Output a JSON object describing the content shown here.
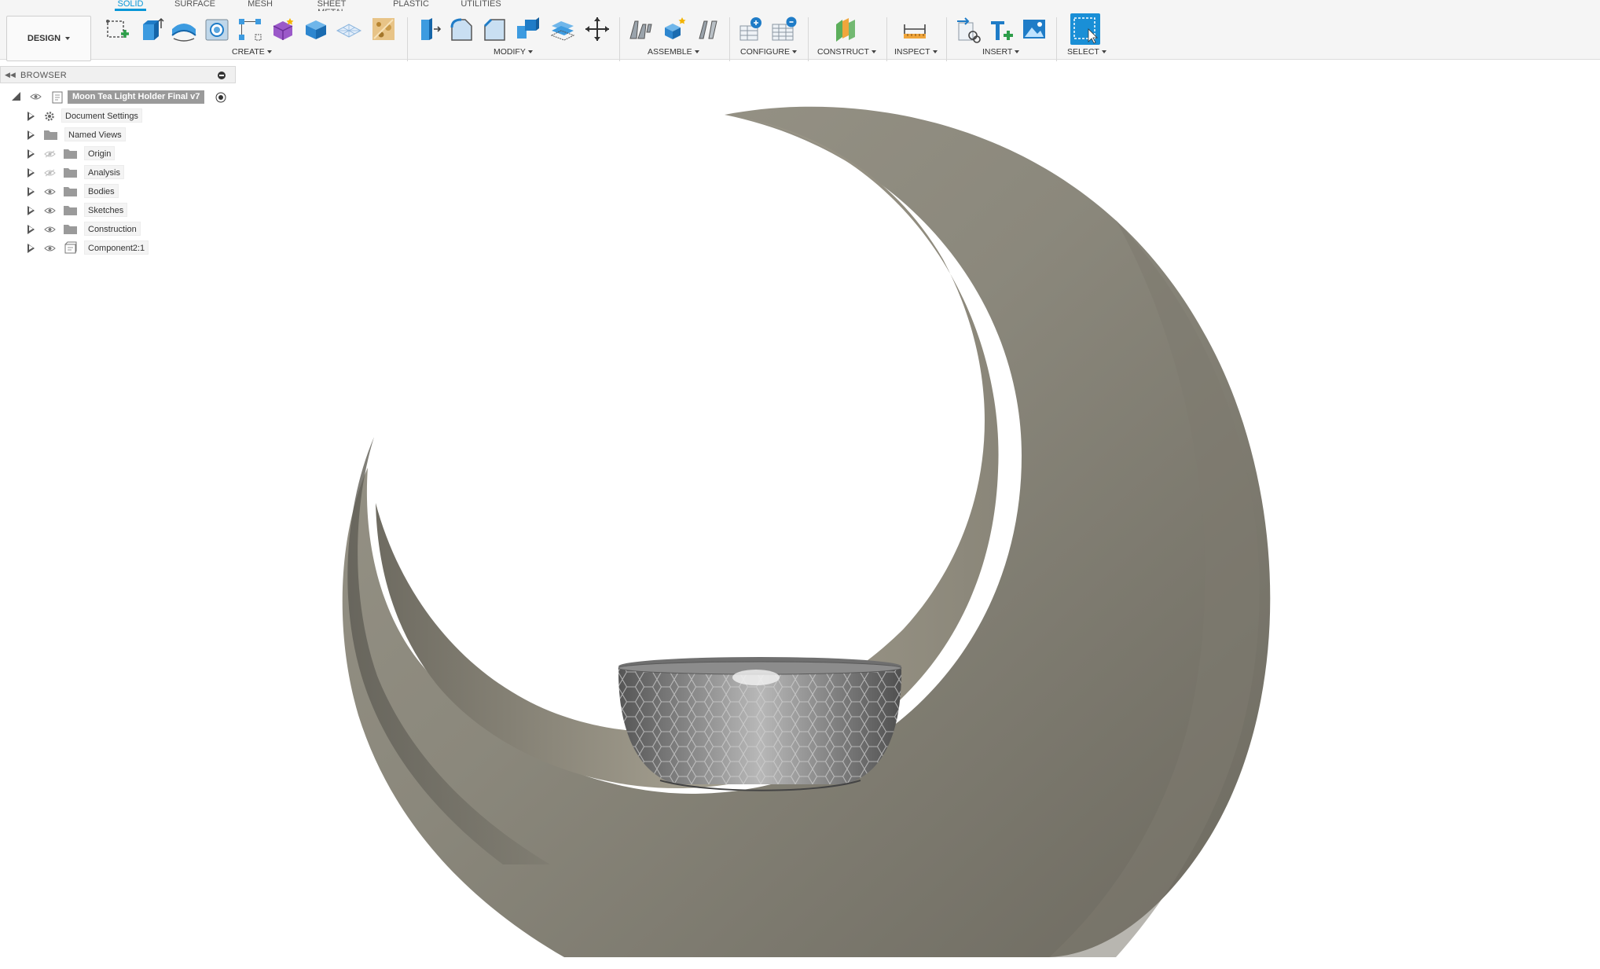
{
  "tabs": [
    {
      "label": "SOLID",
      "active": true
    },
    {
      "label": "SURFACE",
      "active": false
    },
    {
      "label": "MESH",
      "active": false
    },
    {
      "label": "SHEET METAL",
      "active": false
    },
    {
      "label": "PLASTIC",
      "active": false
    },
    {
      "label": "UTILITIES",
      "active": false
    }
  ],
  "workspace": {
    "label": "DESIGN"
  },
  "groups": {
    "create": "CREATE",
    "modify": "MODIFY",
    "assemble": "ASSEMBLE",
    "configure": "CONFIGURE",
    "construct": "CONSTRUCT",
    "inspect": "INSPECT",
    "insert": "INSERT",
    "select": "SELECT"
  },
  "tools": {
    "create": [
      "create-sketch-icon",
      "extrude-icon",
      "revolve-icon",
      "hole-icon",
      "rectangular-pattern-icon",
      "create-form-icon",
      "box-icon",
      "plane-mesh-icon",
      "decal-texture-icon"
    ],
    "modify": [
      "press-pull-icon",
      "fillet-icon",
      "chamfer-icon",
      "combine-icon",
      "offset-face-icon",
      "move-icon"
    ],
    "assemble": [
      "joint-icon",
      "new-component-icon",
      "as-built-joint-icon"
    ],
    "configure": [
      "configure-icon",
      "configuration-table-icon"
    ],
    "construct": [
      "offset-plane-icon"
    ],
    "inspect": [
      "measure-icon"
    ],
    "insert": [
      "insert-derive-icon",
      "insert-mesh-icon",
      "insert-canvas-icon"
    ],
    "select": [
      "select-icon"
    ]
  },
  "browser": {
    "title": "BROWSER",
    "root": "Moon Tea Light Holder Final v7",
    "items": [
      {
        "label": "Document Settings",
        "icon": "gear-icon",
        "visibility": "none"
      },
      {
        "label": "Named Views",
        "icon": "folder-icon",
        "visibility": "none"
      },
      {
        "label": "Origin",
        "icon": "folder-icon",
        "visibility": "hidden"
      },
      {
        "label": "Analysis",
        "icon": "folder-icon",
        "visibility": "hidden"
      },
      {
        "label": "Bodies",
        "icon": "folder-icon",
        "visibility": "visible"
      },
      {
        "label": "Sketches",
        "icon": "folder-icon",
        "visibility": "visible"
      },
      {
        "label": "Construction",
        "icon": "folder-icon",
        "visibility": "visible"
      },
      {
        "label": "Component2:1",
        "icon": "component-icon",
        "visibility": "visible"
      }
    ]
  },
  "colors": {
    "accent": "#0696d7",
    "model_body": "#8a877c",
    "select_active": "#1a8fd6"
  }
}
